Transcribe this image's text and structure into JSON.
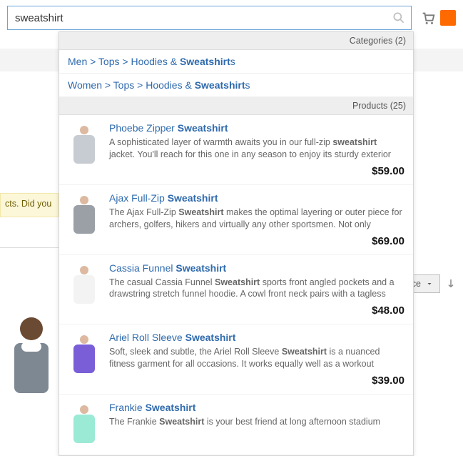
{
  "search": {
    "value": "sweatshirt"
  },
  "categories_header": "Categories (2)",
  "categories": [
    {
      "pre": "Men > Tops > Hoodies & ",
      "match": "Sweatshirt",
      "post": "s"
    },
    {
      "pre": "Women > Tops > Hoodies & ",
      "match": "Sweatshirt",
      "post": "s"
    }
  ],
  "products_header": "Products (25)",
  "products": [
    {
      "title_pre": "Phoebe Zipper ",
      "title_match": "Sweatshirt",
      "title_post": "",
      "desc_pre": "A sophisticated layer of warmth awaits you in our full-zip ",
      "desc_match": "sweatshirt",
      "desc_post": " jacket. You'll reach for this one in any season to enjoy its sturdy exterior",
      "price": "$59.00",
      "tint": "t1"
    },
    {
      "title_pre": "Ajax Full-Zip ",
      "title_match": "Sweatshirt",
      "title_post": "",
      "desc_pre": "The Ajax Full-Zip ",
      "desc_match": "Sweatshirt",
      "desc_post": " makes the optimal layering or outer piece for archers, golfers, hikers and virtually any other sportsmen. Not only",
      "price": "$69.00",
      "tint": "t2"
    },
    {
      "title_pre": "Cassia Funnel ",
      "title_match": "Sweatshirt",
      "title_post": "",
      "desc_pre": "The casual Cassia Funnel ",
      "desc_match": "Sweatshirt",
      "desc_post": " sports front angled pockets and a drawstring stretch funnel hoodie. A cowl front neck pairs with a tagless",
      "price": "$48.00",
      "tint": "t3"
    },
    {
      "title_pre": "Ariel Roll Sleeve ",
      "title_match": "Sweatshirt",
      "title_post": "",
      "desc_pre": "Soft, sleek and subtle, the Ariel Roll Sleeve ",
      "desc_match": "Sweatshirt",
      "desc_post": " is a nuanced fitness garment for all occasions. It works equally well as a workout",
      "price": "$39.00",
      "tint": "t4"
    },
    {
      "title_pre": "Frankie ",
      "title_match": "Sweatshirt",
      "title_post": "",
      "desc_pre": "The Frankie ",
      "desc_match": "Sweatshirt",
      "desc_post": " is your best friend at long afternoon stadium",
      "price": "",
      "tint": "t5"
    }
  ],
  "bg": {
    "msg_fragment": "cts. Did you",
    "sort_fragment": "ce"
  }
}
